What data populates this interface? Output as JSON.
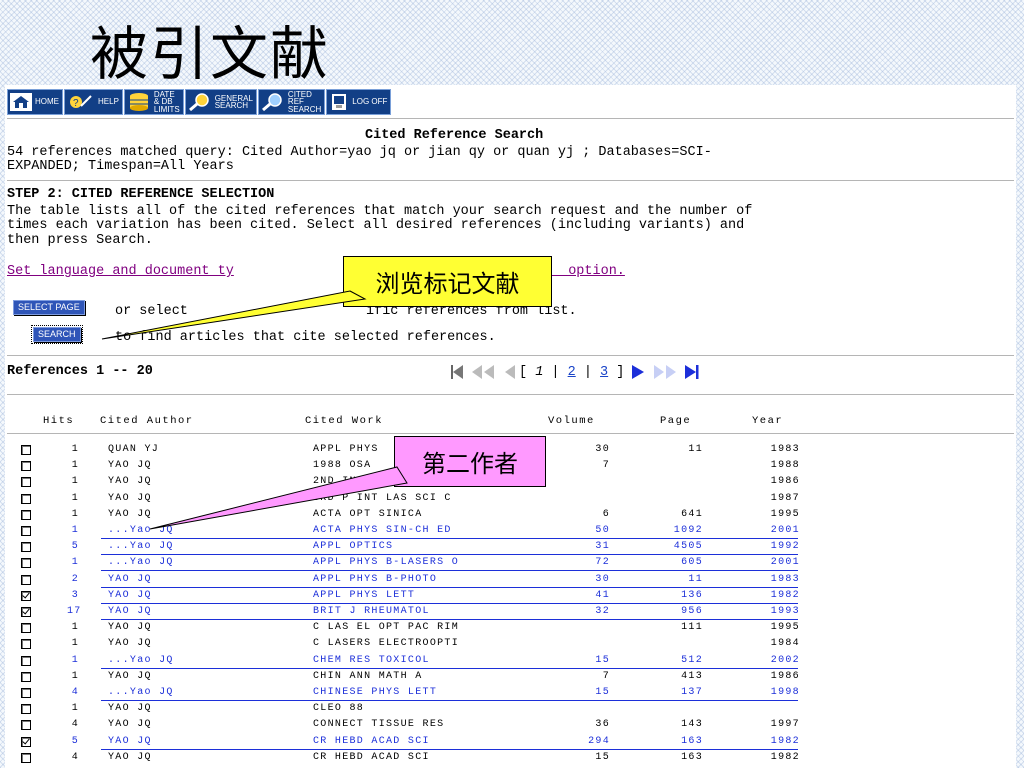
{
  "slide_title": "被引文献",
  "toolbar": [
    {
      "name": "home-button",
      "icon": "home-icon",
      "label": "HOME"
    },
    {
      "name": "help-button",
      "icon": "help-icon",
      "label": "HELP"
    },
    {
      "name": "date-db-limits-button",
      "icon": "database-icon",
      "label": "DATE\n& DB\nLIMITS"
    },
    {
      "name": "general-search-button",
      "icon": "search-icon",
      "label": "GENERAL\nSEARCH"
    },
    {
      "name": "cited-ref-search-button",
      "icon": "search-icon",
      "label": "CITED\nREF\nSEARCH"
    },
    {
      "name": "log-off-button",
      "icon": "logoff-icon",
      "label": "LOG OFF"
    }
  ],
  "page": {
    "heading": "Cited Reference Search",
    "query_line1": "54 references matched query: Cited Author=yao jq or jian qy or quan yj ; Databases=SCI-",
    "query_line2": "EXPANDED; Timespan=All Years",
    "step_title": "STEP 2: CITED REFERENCE SELECTION",
    "desc_line1": "The table lists all of the cited references that match your search request and the number of",
    "desc_line2": "times each variation has been cited. Select all desired references (including variants) and",
    "desc_line3": "then press Search.",
    "set_link_left": "Set language and document ty",
    "set_link_right": "  option.",
    "select_page_btn": "SELECT PAGE",
    "select_text": "or select",
    "select_text2": "ific references from list.",
    "search_btn": "SEARCH",
    "search_text": "to find articles that cite selected references.",
    "references_range": "References 1 -- 20",
    "pager": {
      "open": "[ ",
      "current": "1",
      "sep1": " | ",
      "p2": "2",
      "sep2": " | ",
      "p3": "3",
      "close": " ]"
    }
  },
  "table": {
    "headers": [
      "Hits",
      "Cited Author",
      "Cited Work",
      "Volume",
      "Page",
      "Year"
    ],
    "rows": [
      {
        "checked": false,
        "hl": false,
        "hits": "1",
        "author": "QUAN YJ",
        "work": "APPL PHYS",
        "volume": "30",
        "page": "11",
        "year": "1983"
      },
      {
        "checked": false,
        "hl": false,
        "hits": "1",
        "author": "YAO JQ",
        "work": "1988 OSA",
        "volume": "7",
        "page": "",
        "year": "1988"
      },
      {
        "checked": false,
        "hl": false,
        "hits": "1",
        "author": "YAO JQ",
        "work": "2ND INT",
        "volume": "",
        "page": "",
        "year": "1986"
      },
      {
        "checked": false,
        "hl": false,
        "hits": "1",
        "author": "YAO JQ",
        "work": "3RD P INT LAS SCI C",
        "volume": "",
        "page": "",
        "year": "1987"
      },
      {
        "checked": false,
        "hl": false,
        "hits": "1",
        "author": "YAO JQ",
        "work": "ACTA OPT SINICA",
        "volume": "6",
        "page": "641",
        "year": "1995"
      },
      {
        "checked": false,
        "hl": true,
        "hits": "1",
        "author": "...Yao JQ",
        "work": "ACTA PHYS SIN-CH ED",
        "volume": "50",
        "page": "1092",
        "year": "2001"
      },
      {
        "checked": false,
        "hl": true,
        "hits": "5",
        "author": "...Yao JQ",
        "work": "APPL OPTICS",
        "volume": "31",
        "page": "4505",
        "year": "1992"
      },
      {
        "checked": false,
        "hl": true,
        "hits": "1",
        "author": "...Yao JQ",
        "work": "APPL PHYS B-LASERS O",
        "volume": "72",
        "page": "605",
        "year": "2001"
      },
      {
        "checked": false,
        "hl": true,
        "hits": "2",
        "author": "YAO JQ",
        "work": "APPL PHYS B-PHOTO",
        "volume": "30",
        "page": "11",
        "year": "1983"
      },
      {
        "checked": true,
        "hl": true,
        "hits": "3",
        "author": "YAO JQ",
        "work": "APPL PHYS LETT",
        "volume": "41",
        "page": "136",
        "year": "1982"
      },
      {
        "checked": true,
        "hl": true,
        "hits": "17",
        "author": "YAO JQ",
        "work": "BRIT J RHEUMATOL",
        "volume": "32",
        "page": "956",
        "year": "1993"
      },
      {
        "checked": false,
        "hl": false,
        "hits": "1",
        "author": "YAO JQ",
        "work": "C LAS EL OPT PAC RIM",
        "volume": "",
        "page": "111",
        "year": "1995"
      },
      {
        "checked": false,
        "hl": false,
        "hits": "1",
        "author": "YAO JQ",
        "work": "C LASERS ELECTROOPTI",
        "volume": "",
        "page": "",
        "year": "1984"
      },
      {
        "checked": false,
        "hl": true,
        "hits": "1",
        "author": "...Yao JQ",
        "work": "CHEM RES TOXICOL",
        "volume": "15",
        "page": "512",
        "year": "2002"
      },
      {
        "checked": false,
        "hl": false,
        "hits": "1",
        "author": "YAO JQ",
        "work": "CHIN ANN MATH A",
        "volume": "7",
        "page": "413",
        "year": "1986"
      },
      {
        "checked": false,
        "hl": true,
        "hits": "4",
        "author": "...Yao JQ",
        "work": "CHINESE PHYS LETT",
        "volume": "15",
        "page": "137",
        "year": "1998"
      },
      {
        "checked": false,
        "hl": false,
        "hits": "1",
        "author": "YAO JQ",
        "work": "CLEO 88",
        "volume": "",
        "page": "",
        "year": ""
      },
      {
        "checked": false,
        "hl": false,
        "hits": "4",
        "author": "YAO JQ",
        "work": "CONNECT TISSUE RES",
        "volume": "36",
        "page": "143",
        "year": "1997"
      },
      {
        "checked": true,
        "hl": true,
        "hits": "5",
        "author": "YAO JQ",
        "work": "CR HEBD ACAD SCI",
        "volume": "294",
        "page": "163",
        "year": "1982"
      },
      {
        "checked": false,
        "hl": false,
        "hits": "4",
        "author": "YAO JQ",
        "work": "CR HEBD ACAD SCI",
        "volume": "15",
        "page": "163",
        "year": "1982"
      }
    ]
  },
  "callouts": {
    "browse_mark": "浏览标记文献",
    "second_author": "第二作者"
  },
  "colors": {
    "callout_yellow": "#ffff33",
    "callout_pink": "#ff99ff",
    "link_blue": "#1c2fd9",
    "toolbar_navy": "#123f86"
  }
}
